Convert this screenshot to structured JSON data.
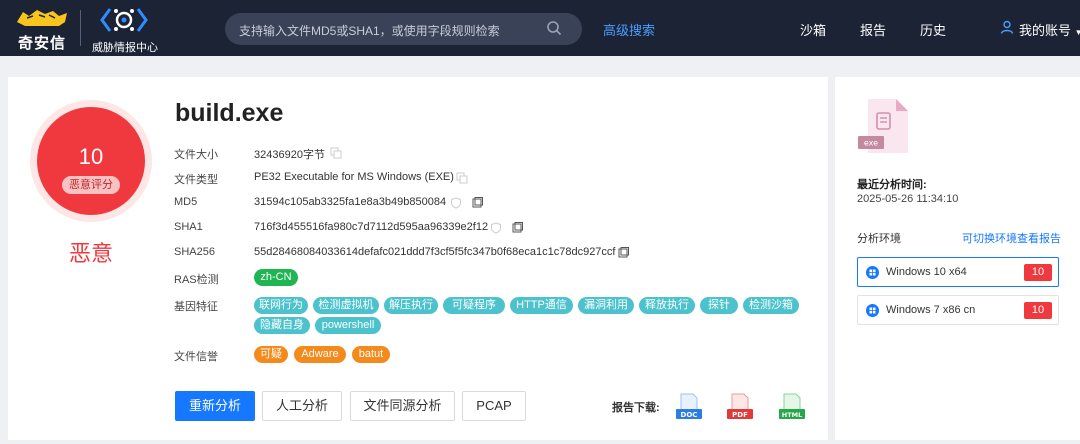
{
  "header": {
    "brand": "奇安信",
    "product": "威胁情报中心",
    "search_placeholder": "支持输入文件MD5或SHA1，或使用字段规则检索",
    "advanced_search": "高级搜索",
    "nav": [
      "沙箱",
      "报告",
      "历史"
    ],
    "account": "我的账号",
    "accent": "#4a9eff",
    "icons": [
      "qianxin-tiger-logo",
      "threat-intel-logo-icon",
      "search-icon",
      "user-icon",
      "caret-down-icon"
    ]
  },
  "score": {
    "value": "10",
    "tag": "恶意评分",
    "verdict": "恶意",
    "color": "#f0393f"
  },
  "file": {
    "name": "build.exe",
    "fields": [
      {
        "label": "文件大小",
        "value": "32436920字节"
      },
      {
        "label": "文件类型",
        "value": "PE32 Executable for MS Windows (EXE)"
      },
      {
        "label": "MD5",
        "value": "31594c105ab3325fa1e8a3b49b850084"
      },
      {
        "label": "SHA1",
        "value": "716f3d455516fa980c7d7112d595aa96339e2f12"
      },
      {
        "label": "SHA256",
        "value": "55d28468084033614defafc021ddd7f3cf5f5fc347b0f68eca1c1c78dc927ccf"
      }
    ],
    "ras_label": "RAS检测",
    "ras_tag": "zh-CN",
    "gene_label": "基因特征",
    "gene_tags": [
      "联网行为",
      "检测虚拟机",
      "解压执行",
      "可疑程序",
      "HTTP通信",
      "漏洞利用",
      "释放执行",
      "探针",
      "检测沙箱",
      "隐藏自身",
      "powershell"
    ],
    "reputation_label": "文件信誉",
    "reputation_tags": [
      "可疑",
      "Adware",
      "batut"
    ]
  },
  "actions": {
    "buttons": [
      "重新分析",
      "人工分析",
      "文件同源分析",
      "PCAP"
    ],
    "download_label": "报告下载:",
    "downloads": [
      "DOC",
      "PDF",
      "HTML"
    ]
  },
  "side": {
    "file_ext": "exe",
    "last_analysis_label": "最近分析时间:",
    "last_analysis_time": "2025-05-26 11:34:10",
    "env_label": "分析环境",
    "env_switch": "可切换环境查看报告",
    "environments": [
      {
        "name": "Windows 10 x64",
        "score": "10",
        "active": true
      },
      {
        "name": "Windows 7 x86 cn",
        "score": "10",
        "active": false
      }
    ]
  }
}
